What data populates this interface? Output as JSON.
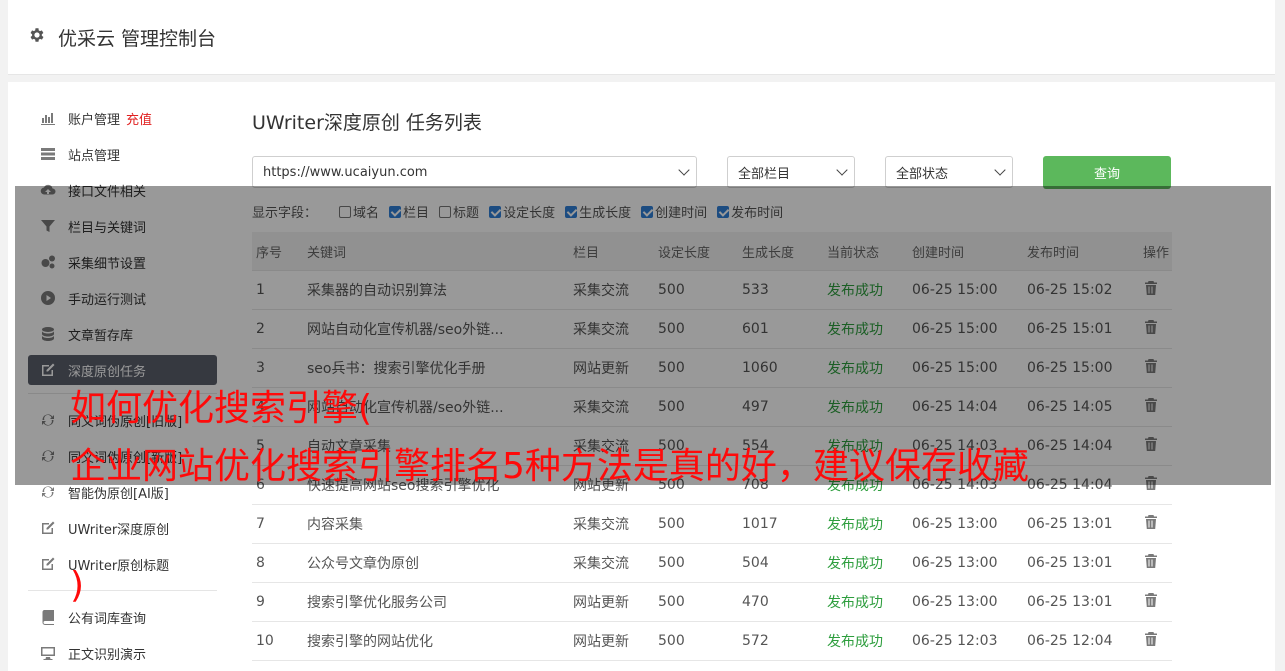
{
  "header": {
    "title": "优采云 管理控制台"
  },
  "sidebar": {
    "items": [
      {
        "label": "账户管理",
        "tag": "充值",
        "icon": "bar-chart-icon"
      },
      {
        "label": "站点管理",
        "icon": "server-icon"
      },
      {
        "label": "接口文件相关",
        "icon": "cloud-upload-icon"
      },
      {
        "label": "栏目与关键词",
        "icon": "filter-icon"
      },
      {
        "label": "采集细节设置",
        "icon": "gears-icon"
      },
      {
        "label": "手动运行测试",
        "icon": "play-circle-icon"
      },
      {
        "label": "文章暂存库",
        "icon": "database-icon"
      },
      {
        "label": "深度原创任务",
        "icon": "edit-icon"
      },
      {
        "label": "同义词伪原创[旧版]",
        "icon": "refresh-icon"
      },
      {
        "label": "同义词伪原创[新版]",
        "icon": "refresh-icon"
      },
      {
        "label": "智能伪原创[AI版]",
        "icon": "refresh-icon"
      },
      {
        "label": "UWriter深度原创",
        "icon": "edit-icon"
      },
      {
        "label": "UWriter原创标题",
        "icon": "edit-icon"
      },
      {
        "label": "公有词库查询",
        "icon": "book-icon"
      },
      {
        "label": "正文识别演示",
        "icon": "monitor-icon"
      }
    ]
  },
  "main": {
    "title": "UWriter深度原创 任务列表",
    "site_select": "https://www.ucaiyun.com",
    "column_select": "全部栏目",
    "status_select": "全部状态",
    "query_button": "查询",
    "fields_label": "显示字段：",
    "fields": [
      {
        "label": "域名",
        "checked": false
      },
      {
        "label": "栏目",
        "checked": true
      },
      {
        "label": "标题",
        "checked": false
      },
      {
        "label": "设定长度",
        "checked": true
      },
      {
        "label": "生成长度",
        "checked": true
      },
      {
        "label": "创建时间",
        "checked": true
      },
      {
        "label": "发布时间",
        "checked": true
      }
    ],
    "columns": [
      "序号",
      "关键词",
      "栏目",
      "设定长度",
      "生成长度",
      "当前状态",
      "创建时间",
      "发布时间",
      "操作"
    ],
    "rows": [
      [
        "1",
        "采集器的自动识别算法",
        "采集交流",
        "500",
        "533",
        "发布成功",
        "06-25 15:00",
        "06-25 15:02"
      ],
      [
        "2",
        "网站自动化宣传机器/seo外链...",
        "采集交流",
        "500",
        "601",
        "发布成功",
        "06-25 15:00",
        "06-25 15:01"
      ],
      [
        "3",
        "seo兵书：搜索引擎优化手册",
        "网站更新",
        "500",
        "1060",
        "发布成功",
        "06-25 15:00",
        "06-25 15:00"
      ],
      [
        "4",
        "网站自动化宣传机器/seo外链...",
        "采集交流",
        "500",
        "497",
        "发布成功",
        "06-25 14:04",
        "06-25 14:05"
      ],
      [
        "5",
        "自动文章采集",
        "采集交流",
        "500",
        "554",
        "发布成功",
        "06-25 14:03",
        "06-25 14:04"
      ],
      [
        "6",
        "快速提高网站seo搜索引擎优化",
        "网站更新",
        "500",
        "708",
        "发布成功",
        "06-25 14:03",
        "06-25 14:04"
      ],
      [
        "7",
        "内容采集",
        "采集交流",
        "500",
        "1017",
        "发布成功",
        "06-25 13:00",
        "06-25 13:01"
      ],
      [
        "8",
        "公众号文章伪原创",
        "采集交流",
        "500",
        "504",
        "发布成功",
        "06-25 13:00",
        "06-25 13:01"
      ],
      [
        "9",
        "搜索引擎优化服务公司",
        "网站更新",
        "500",
        "470",
        "发布成功",
        "06-25 13:00",
        "06-25 13:01"
      ],
      [
        "10",
        "搜索引擎的网站优化",
        "网站更新",
        "500",
        "572",
        "发布成功",
        "06-25 12:03",
        "06-25 12:04"
      ]
    ]
  },
  "overlay_title": {
    "line1": "如何优化搜索引擎(",
    "line2": "企业网站优化搜索引擎排名5种方法是真的好，建议保存收藏",
    "line3": ")"
  }
}
